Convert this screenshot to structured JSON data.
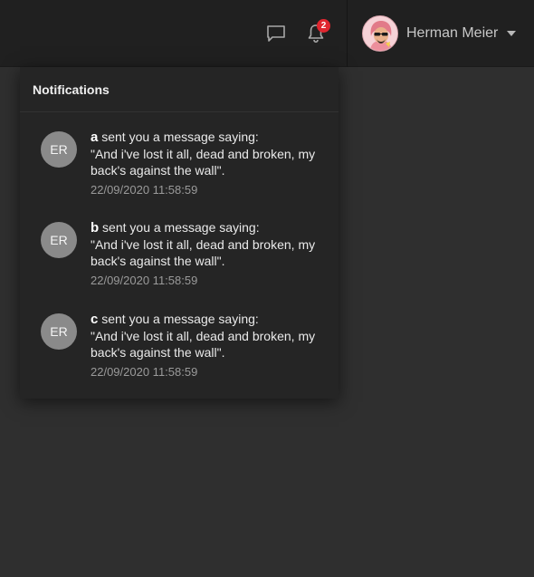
{
  "header": {
    "chat_icon": "chat-icon",
    "bell_icon": "bell-icon",
    "notification_count": "2",
    "user_name": "Herman Meier",
    "caret_icon": "caret-down-icon"
  },
  "notifications": {
    "title": "Notifications",
    "items": [
      {
        "initials": "ER",
        "sender": "a",
        "action": " sent you a message saying:",
        "message": "\"And i've lost it all, dead and broken, my back's against the wall\".",
        "time": "22/09/2020 11:58:59"
      },
      {
        "initials": "ER",
        "sender": "b",
        "action": " sent you a message saying:",
        "message": "\"And i've lost it all, dead and broken, my back's against the wall\".",
        "time": "22/09/2020 11:58:59"
      },
      {
        "initials": "ER",
        "sender": "c",
        "action": " sent you a message saying:",
        "message": "\"And i've lost it all, dead and broken, my back's against the wall\".",
        "time": "22/09/2020 11:58:59"
      }
    ]
  }
}
